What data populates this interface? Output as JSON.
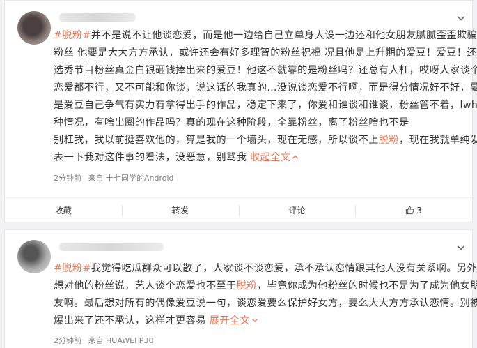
{
  "posts": [
    {
      "lines": [
        [
          {
            "t": "#脱粉#",
            "c": "tag"
          },
          {
            "t": "并不是说不让他谈恋爱，而是他一边给自己立单身人设一边还和他女朋友腻腻歪歪欺骗"
          }
        ],
        [
          {
            "t": "粉丝 他要是大大方方承认，或许还会有好多理智的粉丝祝福 况且他是上升期的爱豆！爱豆！还是"
          }
        ],
        [
          {
            "t": "选秀节目粉丝真金白银砸钱捧出来的爱豆！他这不就靠的是粉丝吗？还总有人杠，哎呀人家谈个"
          }
        ],
        [
          {
            "t": "恋爱都不行，又不可能和你谈，说这话的我真的…没说谈恋爱不行啊，而是得分情况好不好，要"
          }
        ],
        [
          {
            "t": "是爱豆自己争气有实力有拿得出手的作品，稳定下来了，你爱和谁谈和谁谈，粉丝管不着，lwh这"
          }
        ],
        [
          {
            "t": "种情况，有啥出圈的作品吗？真的现在这种阶段，全靠粉丝，离了粉丝啥也不是"
          }
        ],
        [
          {
            "t": "别杠我，我以前挺喜欢他的，算是我的一个墙头，现在无感，所以谈不上"
          },
          {
            "t": "脱粉",
            "c": "hl"
          },
          {
            "t": "，现在我就单纯发"
          }
        ],
        [
          {
            "t": "表一下我对这件事的看法，没恶意，别骂我 "
          },
          {
            "t": "收起全文",
            "c": "more"
          }
        ]
      ],
      "time": "2分钟前",
      "source": "来自 十七同学的Android",
      "actions": {
        "favorite": "收藏",
        "repost": "转发",
        "comment": "评论",
        "like_count": "3"
      }
    },
    {
      "lines": [
        [
          {
            "t": "#脱粉#",
            "c": "tag"
          },
          {
            "t": "我觉得吃瓜群众可以散了，人家谈不谈恋爱，承不承认恋情跟其他人没有关系啊。另外"
          }
        ],
        [
          {
            "t": "想对他的粉丝说，艺人谈个恋爱也不至于"
          },
          {
            "t": "脱粉",
            "c": "hl"
          },
          {
            "t": "，毕竟你成为他粉丝的时候也不是为了成为他女朋"
          }
        ],
        [
          {
            "t": "友啊。最后想对所有的偶像爱豆说一句，谈恋爱要么保护好女方，要么大大方方承认恋情。别被"
          }
        ],
        [
          {
            "t": "爆出来了还不承认，这样才更容易 "
          },
          {
            "t": "展开全文",
            "c": "more"
          }
        ]
      ],
      "time": "2分钟前",
      "source": "来自 HUAWEI P30"
    }
  ]
}
